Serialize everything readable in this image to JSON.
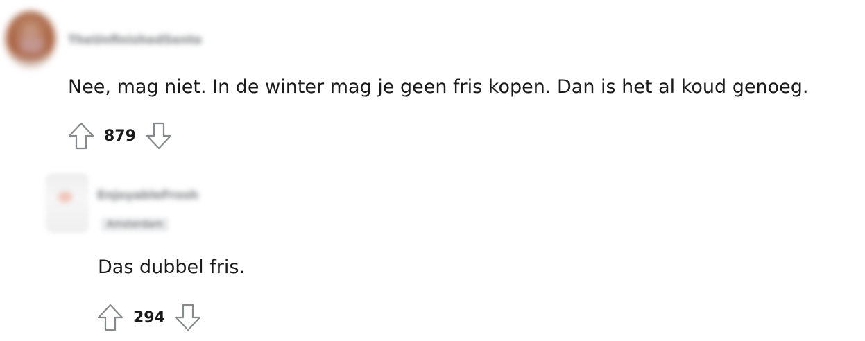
{
  "comments": [
    {
      "username": "TheUnfinishedSente",
      "text": "Nee, mag niet. In de winter mag je geen fris kopen. Dan is het al koud genoeg.",
      "score": "879",
      "icons": {
        "upvote": "arrow-up-icon",
        "downvote": "arrow-down-icon"
      }
    },
    {
      "username": "EnjoyableFrosh",
      "flair": "Amsterdam",
      "text": "Das dubbel fris.",
      "score": "294",
      "icons": {
        "upvote": "arrow-up-icon",
        "downvote": "arrow-down-icon"
      }
    }
  ],
  "colors": {
    "text": "#1a1a1b",
    "icon_stroke": "#878a8c",
    "muted": "#787c7e"
  }
}
